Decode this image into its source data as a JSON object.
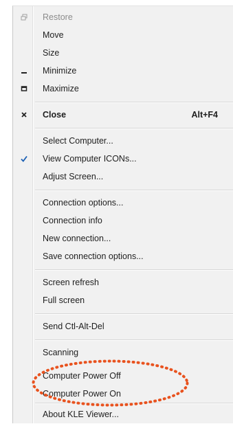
{
  "menu": {
    "items": [
      {
        "label": "Restore",
        "icon": "restore-icon"
      },
      {
        "label": "Move"
      },
      {
        "label": "Size"
      },
      {
        "label": "Minimize",
        "icon": "minimize-icon"
      },
      {
        "label": "Maximize",
        "icon": "maximize-icon"
      },
      {
        "label": "Close",
        "icon": "close-icon",
        "shortcut": "Alt+F4"
      },
      {
        "label": "Select Computer..."
      },
      {
        "label": "View Computer ICONs...",
        "icon": "checkmark-icon",
        "checked": true
      },
      {
        "label": "Adjust Screen..."
      },
      {
        "label": "Connection options..."
      },
      {
        "label": "Connection info"
      },
      {
        "label": "New connection..."
      },
      {
        "label": "Save connection options..."
      },
      {
        "label": "Screen refresh"
      },
      {
        "label": "Full screen"
      },
      {
        "label": "Send Ctl-Alt-Del"
      },
      {
        "label": "Scanning"
      },
      {
        "label": "Computer Power Off"
      },
      {
        "label": "Computer Power On"
      },
      {
        "label": "About KLE Viewer..."
      }
    ]
  },
  "annotation": {
    "color": "#e8521e",
    "style": "dotted-ellipse"
  },
  "colors": {
    "check": "#1a5fb4",
    "disabled_text": "#8c8c8c",
    "menu_bg": "#f1f1f1"
  }
}
